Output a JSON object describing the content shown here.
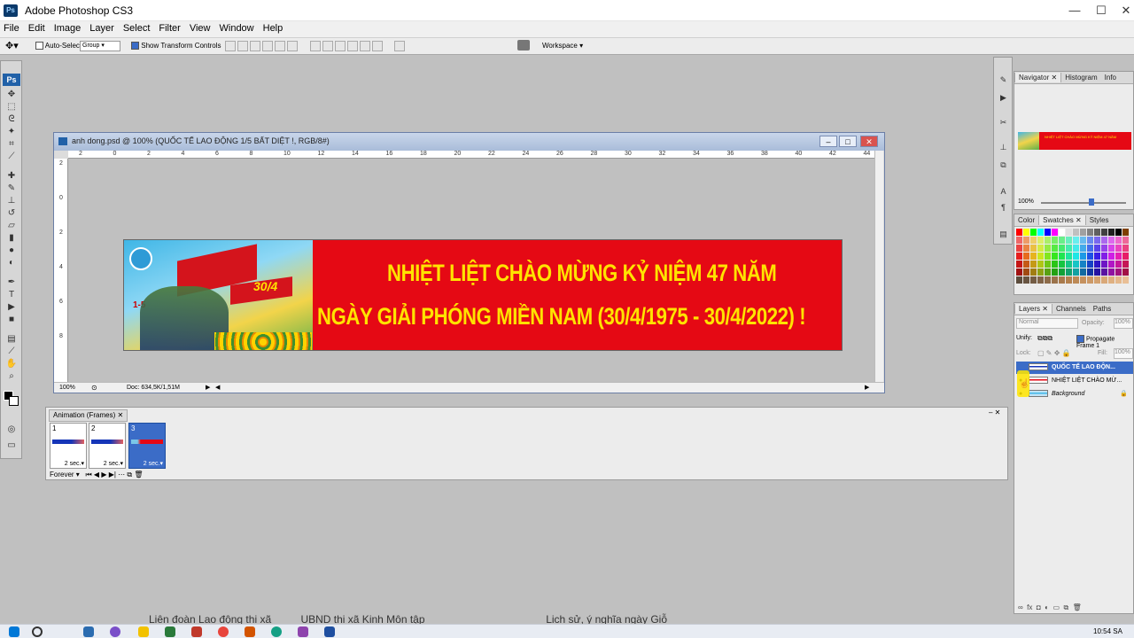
{
  "app": {
    "title": "Adobe Photoshop CS3",
    "logo": "Ps"
  },
  "menu": [
    "File",
    "Edit",
    "Image",
    "Layer",
    "Select",
    "Filter",
    "View",
    "Window",
    "Help"
  ],
  "options": {
    "auto_select_label": "Auto-Select:",
    "auto_select_value": "Group",
    "show_transform_label": "Show Transform Controls",
    "workspace_label": "Workspace ▾"
  },
  "document": {
    "title": "anh dong.psd @ 100% (QUỐC TẾ LAO ĐỘNG 1/5 BẤT DIỆT !, RGB/8#)",
    "zoom": "100%",
    "doc_info": "Doc: 634,5K/1,51M",
    "ruler_top": [
      "2",
      "0",
      "2",
      "4",
      "6",
      "8",
      "10",
      "12",
      "14",
      "16",
      "18",
      "20",
      "22",
      "24",
      "26",
      "28",
      "30",
      "32",
      "34",
      "36",
      "38",
      "40",
      "42",
      "44"
    ],
    "ruler_left": [
      "2",
      "0",
      "2",
      "4",
      "6",
      "8"
    ]
  },
  "banner": {
    "line1": "NHIỆT LIỆT CHÀO MỪNG KỶ NIỆM 47 NĂM",
    "line2": "NGÀY GIẢI PHÓNG MIỀN NAM (30/4/1975 - 30/4/2022) !",
    "art_label_1": "1-5",
    "art_label_2": "30/4"
  },
  "animation": {
    "tab": "Animation (Frames)",
    "frames": [
      {
        "num": "1",
        "duration": "2 sec.▾"
      },
      {
        "num": "2",
        "duration": "2 sec.▾"
      },
      {
        "num": "3",
        "duration": "2 sec.▾"
      }
    ],
    "loop": "Forever"
  },
  "panels": {
    "navigator_tabs": [
      "Navigator",
      "Histogram",
      "Info"
    ],
    "navigator_zoom": "100%",
    "color_tabs": [
      "Color",
      "Swatches",
      "Styles"
    ],
    "layers_tabs": [
      "Layers",
      "Channels",
      "Paths"
    ],
    "blend_mode": "Normal",
    "opacity_label": "Opacity:",
    "opacity_value": "100%",
    "unify_label": "Unify:",
    "propagate_label": "Propagate Frame 1",
    "lock_label": "Lock:",
    "fill_label": "Fill:",
    "fill_value": "100%",
    "layers": [
      {
        "name": "QUỐC TẾ LAO ĐỘN...",
        "selected": true
      },
      {
        "name": "NHIỆT LIỆT CHÀO MỪ...",
        "selected": false
      },
      {
        "name": "Background",
        "selected": false
      }
    ]
  },
  "background_text": "Liên đoàn Lao động thị xã          UBND thị xã Kinh Môn tập                                         Lịch sử, ý nghĩa ngày Giỗ",
  "clock": "10:54 SA",
  "colors": {
    "banner_red": "#e50914",
    "banner_text": "#ffe300",
    "selection_blue": "#3b6cc7"
  }
}
